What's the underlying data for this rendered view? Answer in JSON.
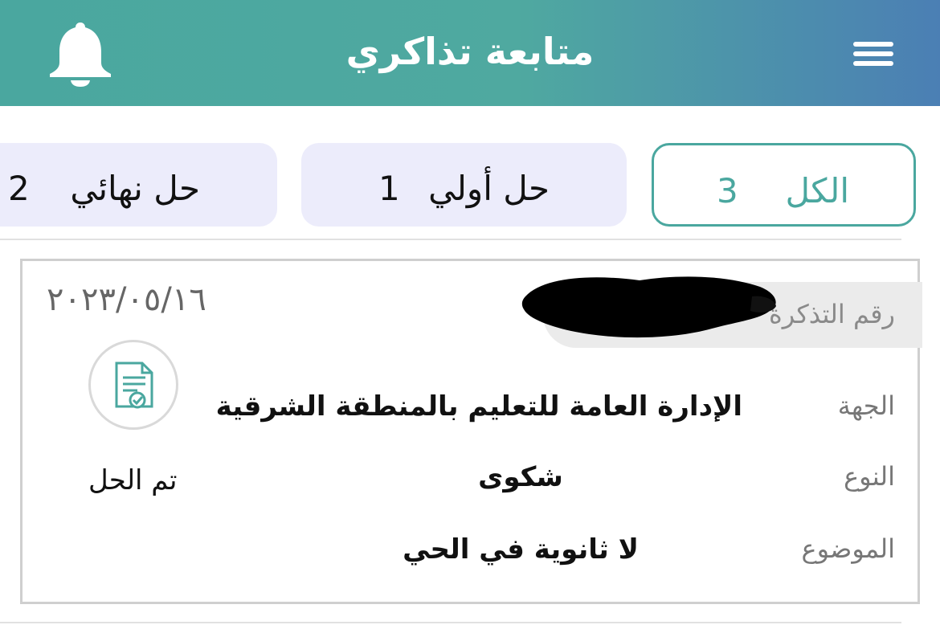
{
  "header": {
    "title": "متابعة تذاكري",
    "menu_icon": "hamburger-menu-icon",
    "notification_icon": "bell-icon",
    "gradient": [
      "#4aa79f",
      "#4b7fb4"
    ]
  },
  "tabs": [
    {
      "label": "الكل",
      "count": "3",
      "active": true
    },
    {
      "label": "حل أولي",
      "count": "1",
      "active": false
    },
    {
      "label": "حل نهائي",
      "count": "2",
      "active": false
    }
  ],
  "ticket": {
    "number_label": "رقم التذكرة",
    "number_value": "",
    "date": "٢٠٢٣/٠٥/١٦",
    "status_icon": "document-check-icon",
    "status": "تم الحل",
    "fields": [
      {
        "label": "الجهة",
        "value": "الإدارة العامة للتعليم بالمنطقة الشرقية"
      },
      {
        "label": "النوع",
        "value": "شكوى"
      },
      {
        "label": "الموضوع",
        "value": "لا ثانوية في الحي"
      }
    ]
  },
  "colors": {
    "accent": "#4aa79f",
    "tab_background": "#ececfb",
    "card_border": "#cfcfcf"
  }
}
